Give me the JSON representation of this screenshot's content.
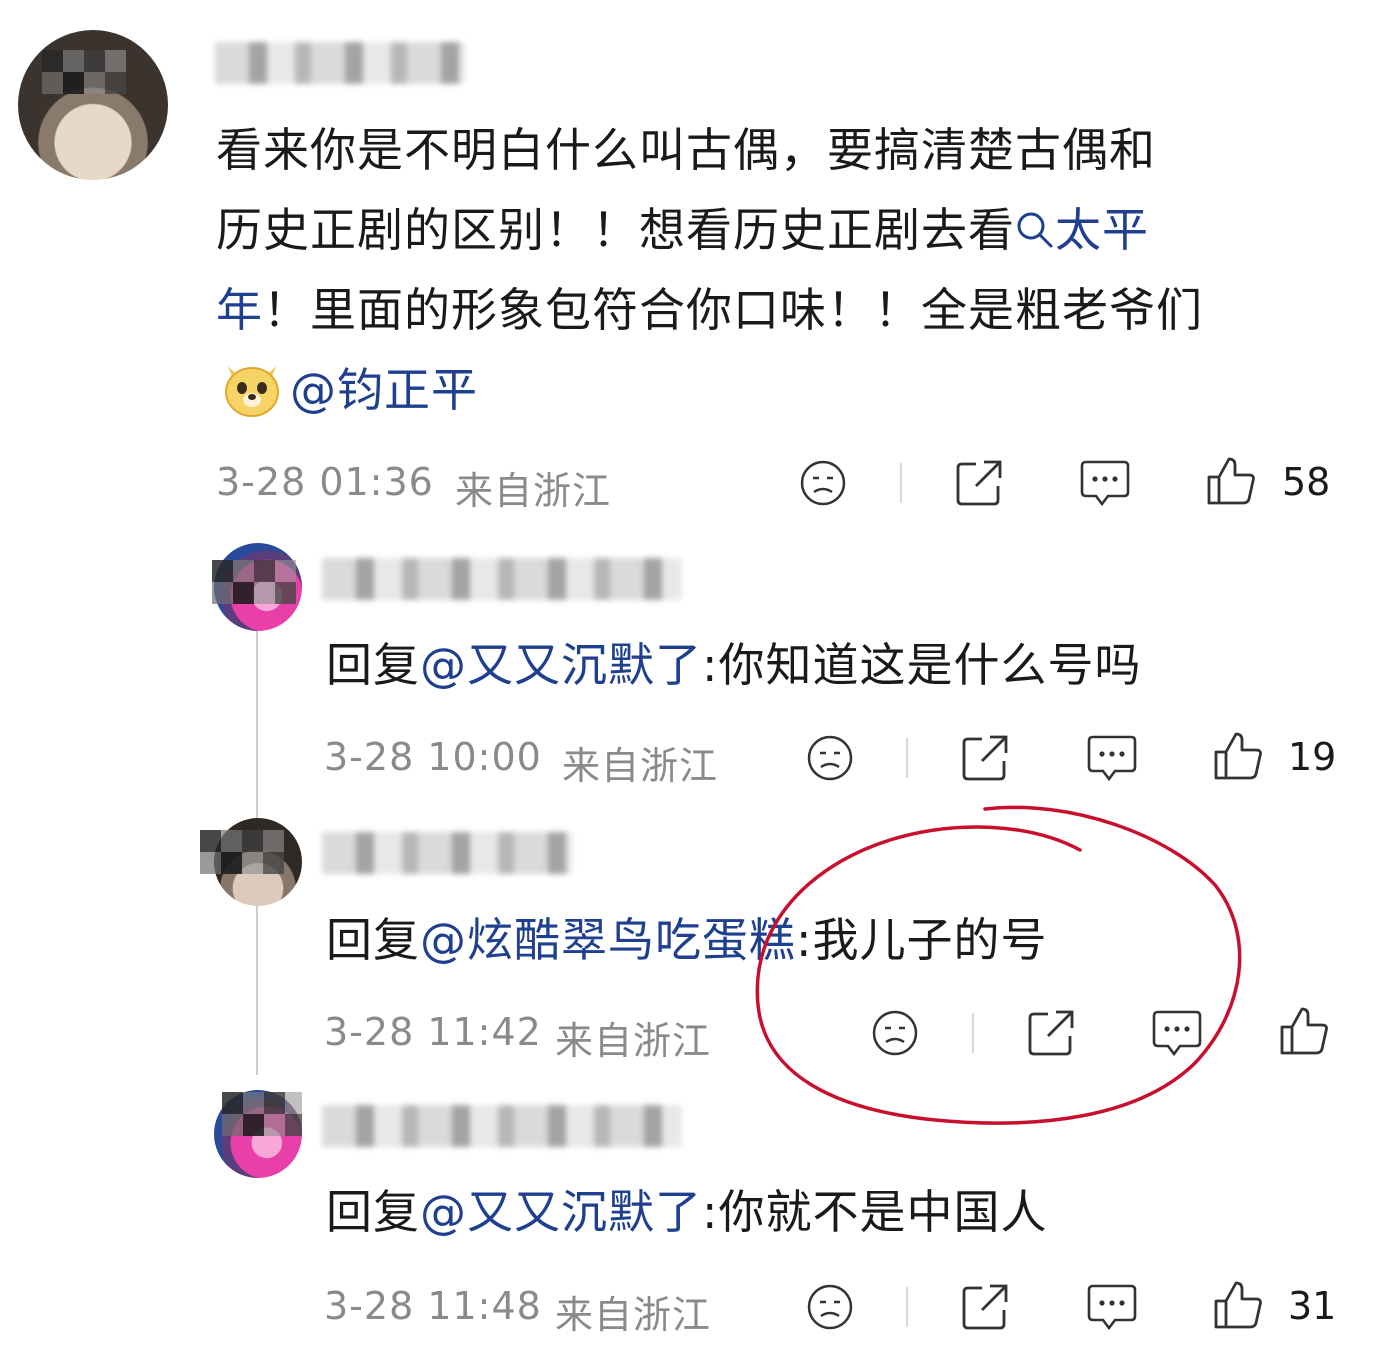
{
  "comment": {
    "body_line1": "看来你是不明白什么叫古偶，要搞清楚古偶和",
    "body_line2_a": "历史正剧的区别！！想看历史正剧去看",
    "body_line2_link": "太平",
    "body_line3_link": "年",
    "body_line3_b": "！里面的形象包符合你口味！！全是粗老爷们",
    "body_line4_mention": "@钧正平",
    "time": "3-28 01:36",
    "location": "来自浙江",
    "likes": "58",
    "emoji_icon": "doge-emoji-icon",
    "search_icon": "search-icon"
  },
  "replies": [
    {
      "prefix": "回复",
      "mention": "@又又沉默了",
      "text": ":你知道这是什么号吗",
      "time": "3-28 10:00",
      "location": "来自浙江",
      "likes": "19"
    },
    {
      "prefix": "回复",
      "mention": "@炫酷翠鸟吃蛋糕",
      "text": ":我儿子的号",
      "time": "3-28 11:42",
      "location": "来自浙江",
      "likes": ""
    },
    {
      "prefix": "回复",
      "mention": "@又又沉默了",
      "text": ":你就不是中国人",
      "time": "3-28 11:48",
      "location": "来自浙江",
      "likes": "31"
    }
  ],
  "colors": {
    "link": "#1f3f8f",
    "meta": "#8a8a8a",
    "annotation": "#c8102e"
  }
}
